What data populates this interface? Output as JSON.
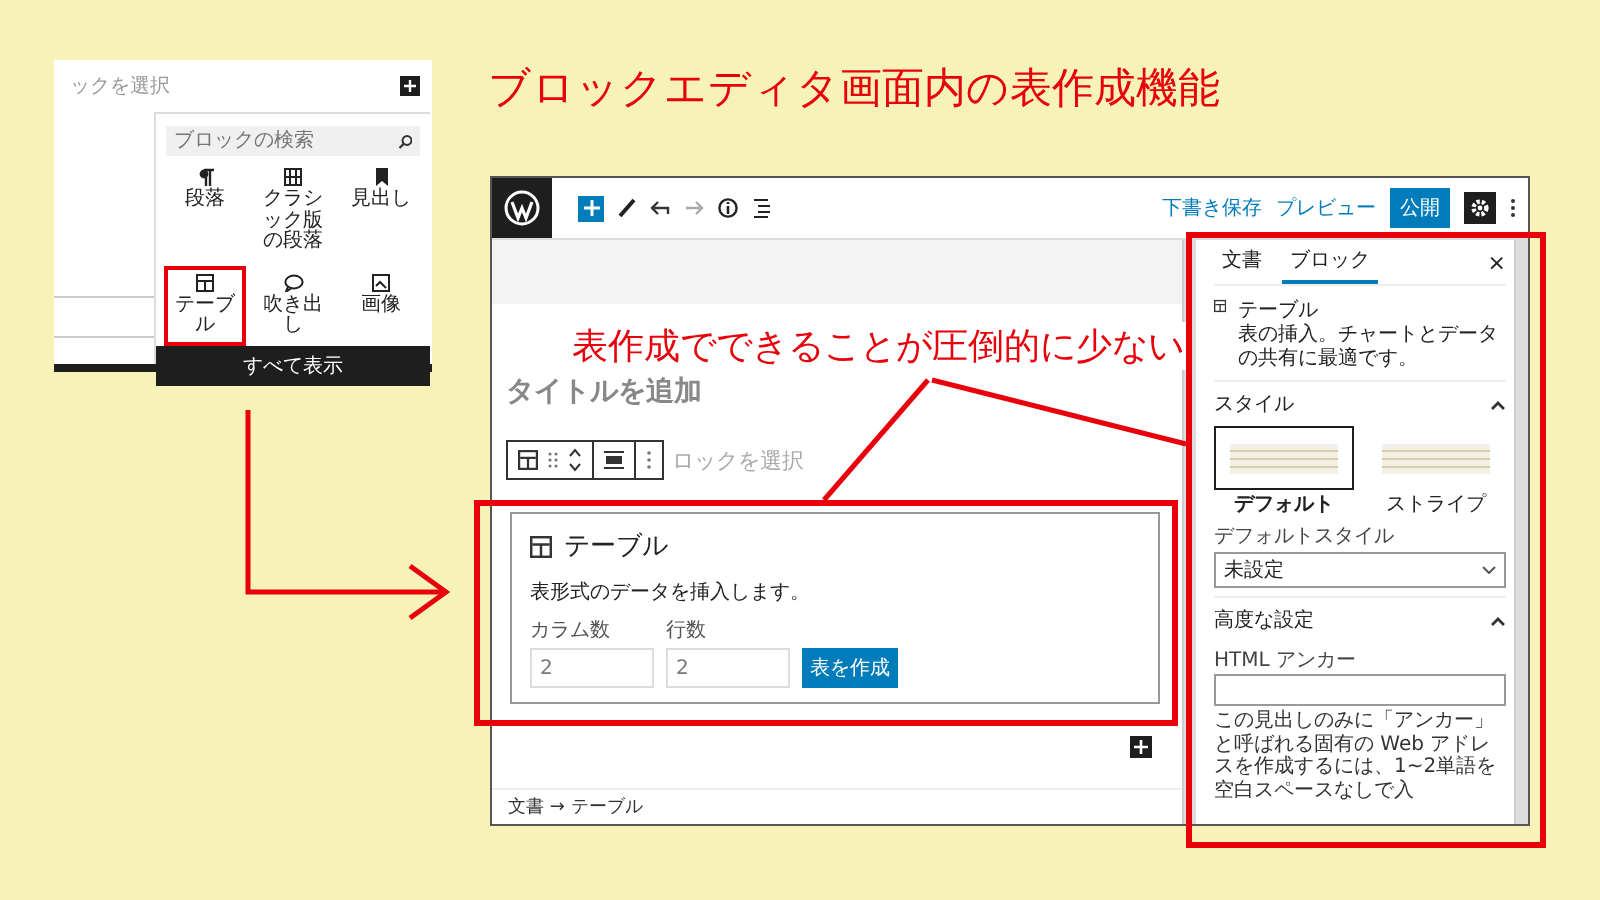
{
  "heading": "ブロックエディタ画面内の表作成機能",
  "inserter": {
    "top_text": "ックを選択",
    "search": {
      "placeholder": "ブロックの検索"
    },
    "blocks": [
      {
        "label": "段落",
        "kind": "paragraph",
        "selected": false
      },
      {
        "label": "クラシック版の段落",
        "kind": "classic",
        "selected": false
      },
      {
        "label": "見出し",
        "kind": "bookmark",
        "selected": false
      },
      {
        "label": "テーブル",
        "kind": "table",
        "selected": true
      },
      {
        "label": "吹き出し",
        "kind": "bubble",
        "selected": false
      },
      {
        "label": "画像",
        "kind": "image",
        "selected": false
      }
    ],
    "show_all": "すべて表示"
  },
  "editor": {
    "toolbar": {
      "save_draft": "下書き保存",
      "preview": "プレビュー",
      "publish": "公開"
    },
    "title_placeholder": "タイトルを追加",
    "block_hint": "ロックを選択",
    "table_block": {
      "title": "テーブル",
      "description": "表形式のデータを挿入します。",
      "columns_label": "カラム数",
      "columns_value": "2",
      "rows_label": "行数",
      "rows_value": "2",
      "create_button": "表を作成"
    },
    "breadcrumb": "文書 → テーブル"
  },
  "callout": "表作成でできることが圧倒的に少ない",
  "sidebar": {
    "tabs": [
      {
        "label": "文書",
        "selected": false
      },
      {
        "label": "ブロック",
        "selected": true
      }
    ],
    "close": "×",
    "block": {
      "title": "テーブル",
      "description": "表の挿入。チャートとデータの共有に最適です。"
    },
    "style_section": {
      "title": "スタイル",
      "expanded": true,
      "options": [
        {
          "label": "デフォルト",
          "selected": true
        },
        {
          "label": "ストライプ",
          "selected": false
        }
      ],
      "default_style_label": "デフォルトスタイル",
      "default_style_value": "未設定"
    },
    "advanced_section": {
      "title": "高度な設定",
      "expanded": true,
      "anchor_label": "HTML アンカー",
      "help": "この見出しのみに「アンカー」と呼ばれる固有の Web アドレスを作成するには、1~2単語を空白スペースなしで入"
    }
  }
}
